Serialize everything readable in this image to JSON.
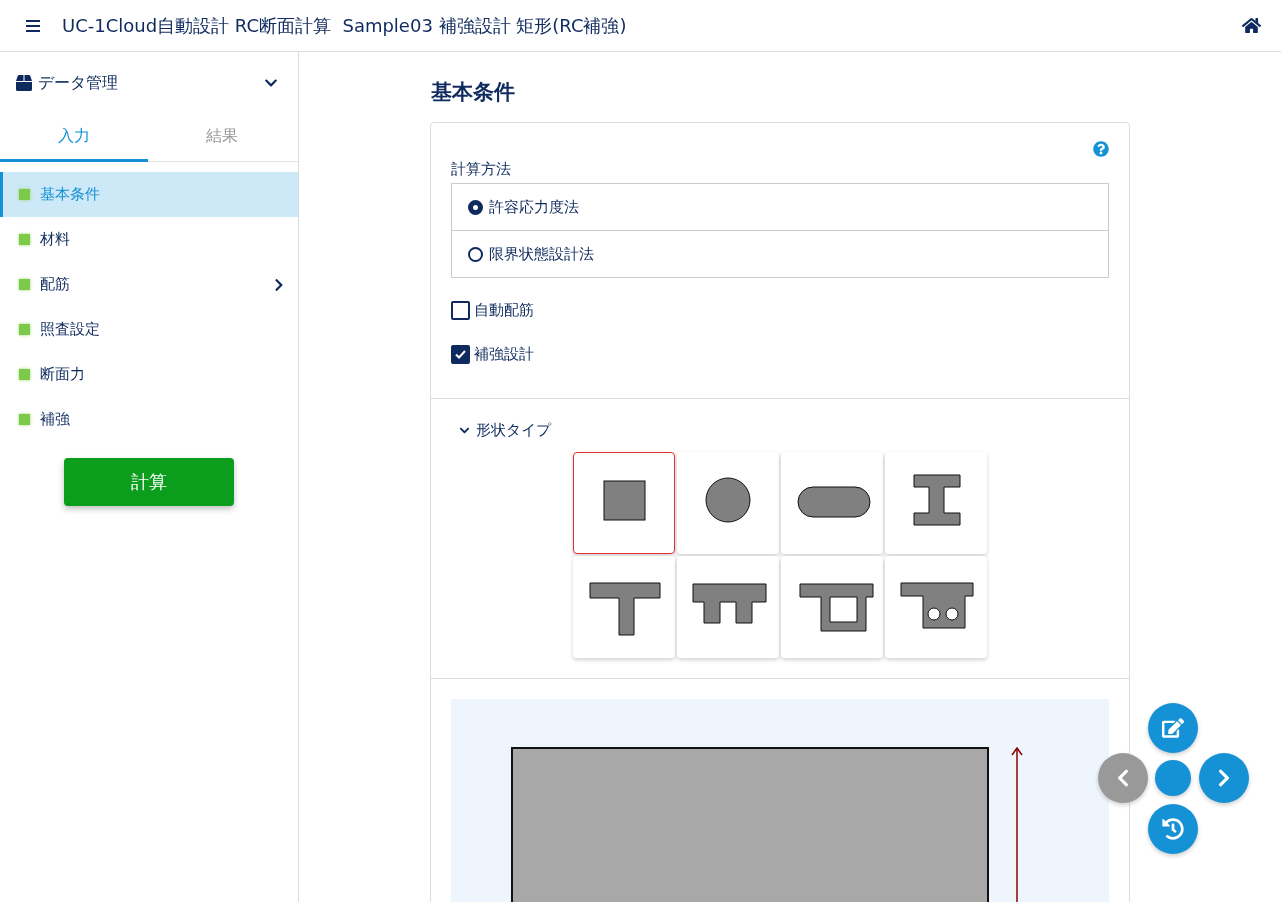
{
  "header": {
    "title": "UC-1Cloud自動設計 RC断面計算  Sample03 補強設計 矩形(RC補強)"
  },
  "sidebar": {
    "section": {
      "label": "データ管理",
      "expanded": true
    },
    "tabs": [
      {
        "label": "入力",
        "selected": true
      },
      {
        "label": "結果",
        "selected": false
      }
    ],
    "items": [
      {
        "label": "基本条件",
        "selected": true,
        "expandable": false
      },
      {
        "label": "材料",
        "selected": false,
        "expandable": false
      },
      {
        "label": "配筋",
        "selected": false,
        "expandable": true
      },
      {
        "label": "照査設定",
        "selected": false,
        "expandable": false
      },
      {
        "label": "断面力",
        "selected": false,
        "expandable": false
      },
      {
        "label": "補強",
        "selected": false,
        "expandable": false
      }
    ],
    "action_button": "計算"
  },
  "main": {
    "title": "基本条件",
    "calc_method": {
      "label": "計算方法",
      "options": [
        {
          "label": "許容応力度法",
          "selected": true
        },
        {
          "label": "限界状態設計法",
          "selected": false
        }
      ]
    },
    "checkboxes": [
      {
        "label": "自動配筋",
        "checked": false
      },
      {
        "label": "補強設計",
        "checked": true
      }
    ],
    "shape_type": {
      "label": "形状タイプ",
      "expanded": true,
      "shapes": [
        {
          "kind": "rectangle",
          "selected": true
        },
        {
          "kind": "circle",
          "selected": false
        },
        {
          "kind": "oval",
          "selected": false
        },
        {
          "kind": "i-beam",
          "selected": false
        },
        {
          "kind": "t-beam",
          "selected": false
        },
        {
          "kind": "pi-beam",
          "selected": false
        },
        {
          "kind": "box",
          "selected": false
        },
        {
          "kind": "hollow-slab",
          "selected": false
        }
      ]
    }
  }
}
